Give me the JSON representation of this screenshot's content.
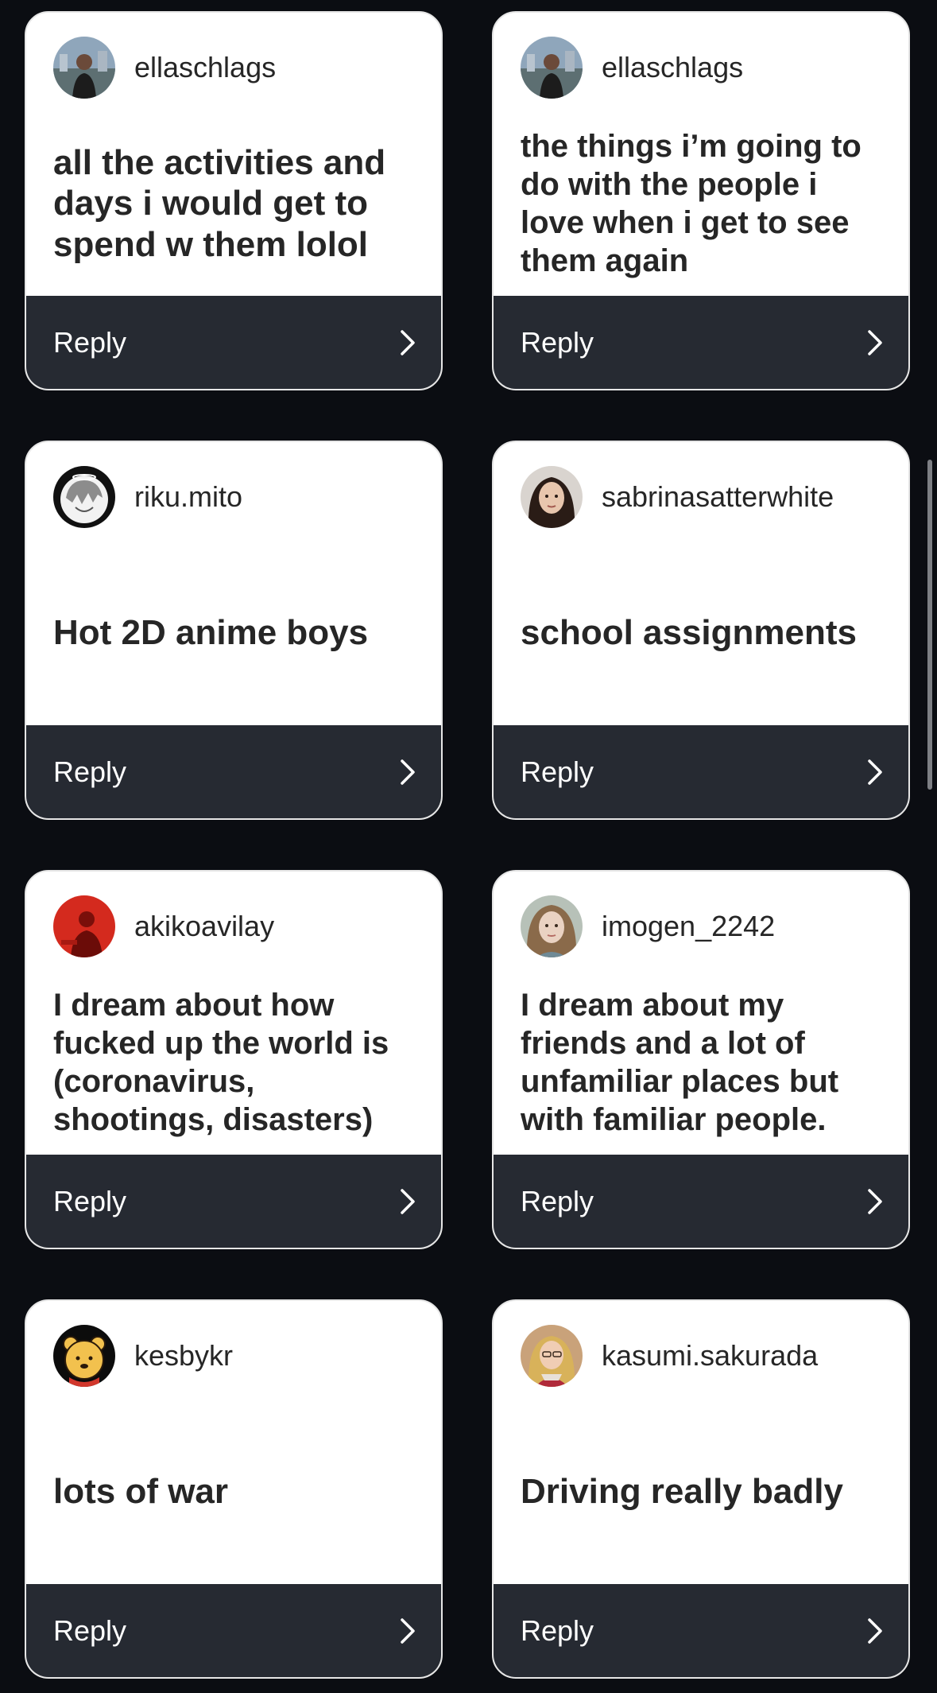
{
  "reply_label": "Reply",
  "cards": [
    {
      "username": "ellaschlags",
      "text": "all the activities and days i would get to spend w them lolol",
      "avatar": "photo-avatar"
    },
    {
      "username": "ellaschlags",
      "text": "the things i’m going to do with the people i love when i get to see them again",
      "avatar": "photo-avatar"
    },
    {
      "username": "riku.mito",
      "text": "Hot 2D anime boys",
      "avatar": "anime-avatar"
    },
    {
      "username": "sabrinasatterwhite",
      "text": "school assignments",
      "avatar": "photo-avatar"
    },
    {
      "username": "akikoavilay",
      "text": "I dream about how fucked up the world is (coronavirus, shootings, disasters)",
      "avatar": "red-photo-avatar"
    },
    {
      "username": "imogen_2242",
      "text": "I dream about my friends and a lot of unfamiliar places but with familiar people.",
      "avatar": "photo-avatar"
    },
    {
      "username": "kesbykr",
      "text": "lots of war",
      "avatar": "bear-avatar"
    },
    {
      "username": "kasumi.sakurada",
      "text": "Driving really badly",
      "avatar": "photo-avatar"
    }
  ],
  "colors": {
    "background": "#0b0d12",
    "card": "#ffffff",
    "footer": "#262a32",
    "text": "#262626"
  }
}
